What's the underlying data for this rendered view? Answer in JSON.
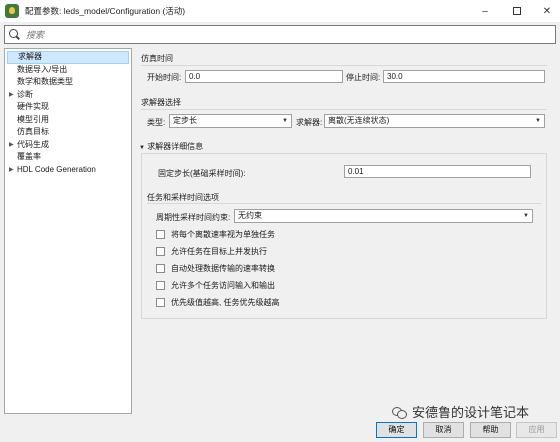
{
  "window": {
    "title": "配置参数: leds_model/Configuration (活动)",
    "controls": [
      "–",
      "□",
      "✕"
    ]
  },
  "search": {
    "placeholder": "搜索"
  },
  "nav": {
    "items": [
      {
        "label": "求解器",
        "selected": true,
        "expandable": false
      },
      {
        "label": "数据导入/导出",
        "selected": false,
        "expandable": false
      },
      {
        "label": "数学和数据类型",
        "selected": false,
        "expandable": false
      },
      {
        "label": "诊断",
        "selected": false,
        "expandable": true
      },
      {
        "label": "硬件实现",
        "selected": false,
        "expandable": false
      },
      {
        "label": "模型引用",
        "selected": false,
        "expandable": false
      },
      {
        "label": "仿真目标",
        "selected": false,
        "expandable": false
      },
      {
        "label": "代码生成",
        "selected": false,
        "expandable": true
      },
      {
        "label": "覆盖率",
        "selected": false,
        "expandable": false
      },
      {
        "label": "HDL Code Generation",
        "selected": false,
        "expandable": true
      }
    ]
  },
  "sim_time": {
    "section": "仿真时间",
    "start_label": "开始时间:",
    "start_value": "0.0",
    "stop_label": "停止时间:",
    "stop_value": "30.0"
  },
  "solver_select": {
    "section": "求解器选择",
    "type_label": "类型:",
    "type_value": "定步长",
    "solver_label": "求解器:",
    "solver_value": "离散(无连续状态)"
  },
  "solver_details": {
    "section": "求解器详细信息",
    "step_label": "固定步长(基础采样时间):",
    "step_value": "0.01"
  },
  "tasking": {
    "section": "任务和采样时间选项",
    "periodic_label": "周期性采样时间约束:",
    "periodic_value": "无约束",
    "options": [
      {
        "label": "将每个离散速率视为单独任务",
        "checked": false
      },
      {
        "label": "允许任务在目标上并发执行",
        "checked": false
      },
      {
        "label": "自动处理数据传输的速率转换",
        "checked": false
      },
      {
        "label": "允许多个任务访问输入和输出",
        "checked": false
      },
      {
        "label": "优先级值越高, 任务优先级越高",
        "checked": false
      }
    ]
  },
  "buttons": {
    "ok": "确定",
    "cancel": "取消",
    "help": "帮助",
    "apply": "应用"
  },
  "watermark": {
    "text": "安德鲁的设计笔记本",
    "icon": "wechat-icon"
  }
}
